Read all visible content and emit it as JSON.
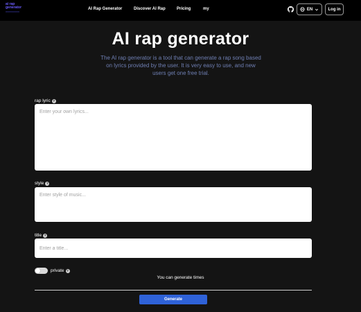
{
  "header": {
    "logo": {
      "line1": "ai rap",
      "line2": "generator",
      "line3": "xxxxxxxxxx"
    },
    "nav": [
      {
        "label": "AI Rap Generator"
      },
      {
        "label": "Discover AI Rap"
      },
      {
        "label": "Pricing"
      },
      {
        "label": "my"
      }
    ],
    "language": {
      "label": "EN"
    },
    "login_label": "Log in"
  },
  "hero": {
    "title": "AI rap generator",
    "description": "The AI rap generator is a tool that can generate a rap song based on lyrics provided by the user. It is very easy to use, and new users get one free trial."
  },
  "form": {
    "lyrics": {
      "label": "rap lyric",
      "placeholder": "Enter your own lyrics..."
    },
    "style": {
      "label": "style",
      "placeholder": "Enter style of music..."
    },
    "title": {
      "label": "title",
      "placeholder": "Enter a title..."
    },
    "private": {
      "label": "private",
      "enabled": false
    },
    "help_glyph": "?",
    "generate_info": "You can generate times",
    "generate_label": "Generate"
  },
  "icons": {
    "github": "github-icon",
    "globe": "globe-icon",
    "chevron": "chevron-down-icon",
    "help": "help-icon"
  },
  "colors": {
    "background": "#141414",
    "header": "#000000",
    "accent": "#2f62d8",
    "description": "#6f7fb3",
    "logo": "#6b5cff"
  }
}
